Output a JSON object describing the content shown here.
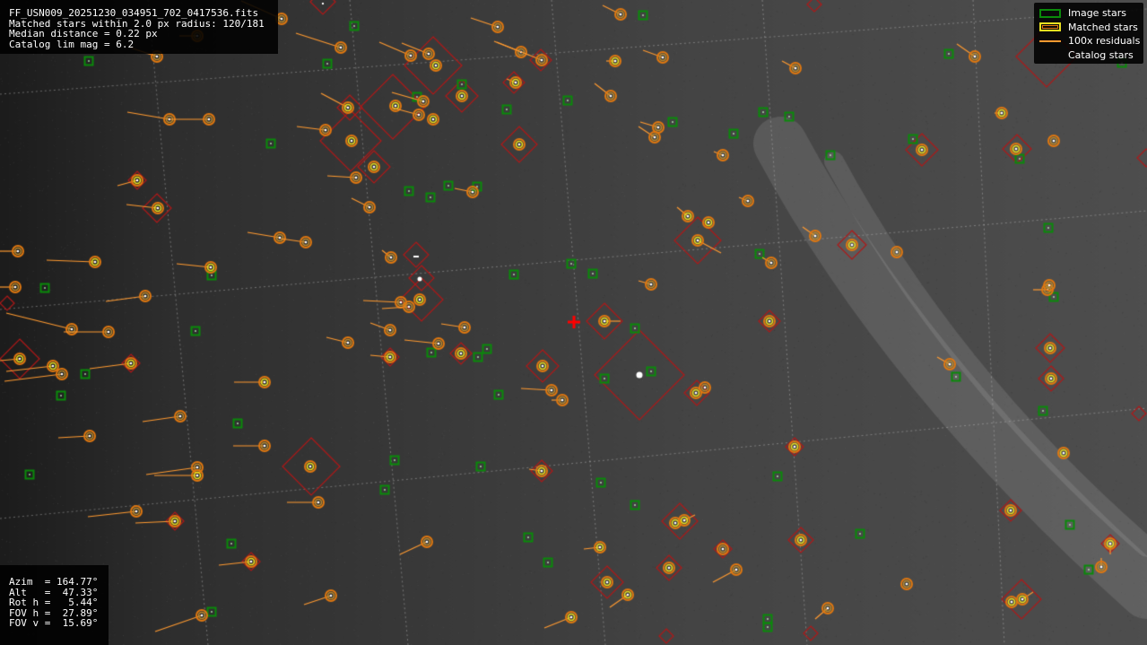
{
  "header": {
    "filename": "FF_USN009_20251230_034951_702_0417536.fits",
    "matched_line": "Matched stars within 2.0 px radius: 120/181",
    "median_line": "Median distance = 0.22 px",
    "catalog_line": "Catalog lim mag = 6.2"
  },
  "pointing": {
    "azim": "Azim  = 164.77°",
    "alt": "Alt   =  47.33°",
    "rot": "Rot h =   5.44°",
    "fov_h": "FOV h =  27.89°",
    "fov_v": "FOV v =  15.69°"
  },
  "legend": {
    "image_stars": "Image stars",
    "matched_stars": "Matched stars",
    "residuals": "100x residuals",
    "catalog_stars": "Catalog stars"
  },
  "colors": {
    "image_star": "#0a8a0a",
    "matched_outer": "#e07810",
    "matched_inner": "#e8e020",
    "residual": "#ff9a30",
    "catalog": "#b01818",
    "center_marker": "#ff0000",
    "grid": "#bfbfbf"
  }
}
